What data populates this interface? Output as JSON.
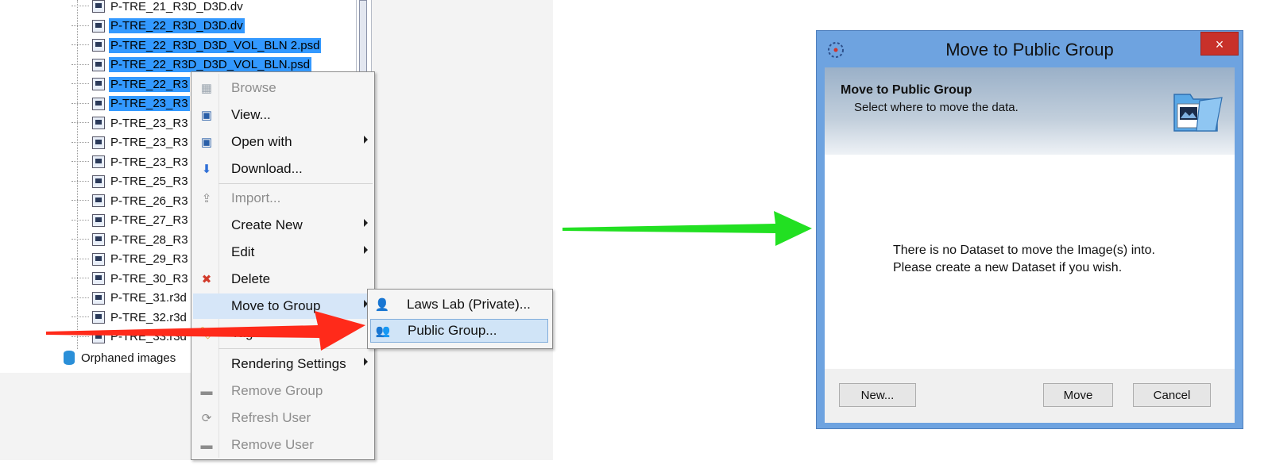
{
  "tree": {
    "items": [
      {
        "label": "P-TRE_21_R3D_D3D.dv",
        "selected": false
      },
      {
        "label": "P-TRE_22_R3D_D3D.dv",
        "selected": true
      },
      {
        "label": "P-TRE_22_R3D_D3D_VOL_BLN 2.psd",
        "selected": true
      },
      {
        "label": "P-TRE_22_R3D_D3D_VOL_BLN.psd",
        "selected": true
      },
      {
        "label": "P-TRE_22_R3",
        "selected": true
      },
      {
        "label": "P-TRE_23_R3",
        "selected": true
      },
      {
        "label": "P-TRE_23_R3",
        "selected": false
      },
      {
        "label": "P-TRE_23_R3",
        "selected": false
      },
      {
        "label": "P-TRE_23_R3",
        "selected": false
      },
      {
        "label": "P-TRE_25_R3",
        "selected": false
      },
      {
        "label": "P-TRE_26_R3",
        "selected": false
      },
      {
        "label": "P-TRE_27_R3",
        "selected": false
      },
      {
        "label": "P-TRE_28_R3",
        "selected": false
      },
      {
        "label": "P-TRE_29_R3",
        "selected": false
      },
      {
        "label": "P-TRE_30_R3",
        "selected": false
      },
      {
        "label": "P-TRE_31.r3d",
        "selected": false
      },
      {
        "label": "P-TRE_32.r3d",
        "selected": false
      },
      {
        "label": "P-TRE_33.r3d",
        "selected": false
      }
    ],
    "orphaned_label": "Orphaned images"
  },
  "context_menu": {
    "items": [
      {
        "label": "Browse",
        "icon": "browse-icon",
        "disabled": true,
        "submenu": false
      },
      {
        "label": "View...",
        "icon": "view-icon",
        "disabled": false,
        "submenu": false
      },
      {
        "label": "Open with",
        "icon": "open-with-icon",
        "disabled": false,
        "submenu": true
      },
      {
        "label": "Download...",
        "icon": "download-icon",
        "disabled": false,
        "submenu": false
      },
      {
        "label": "Import...",
        "icon": "import-icon",
        "disabled": true,
        "submenu": false
      },
      {
        "label": "Create New",
        "icon": "",
        "disabled": false,
        "submenu": true
      },
      {
        "label": "Edit",
        "icon": "",
        "disabled": false,
        "submenu": true
      },
      {
        "label": "Delete",
        "icon": "delete-icon",
        "disabled": false,
        "submenu": false
      },
      {
        "label": "Move to Group",
        "icon": "",
        "disabled": false,
        "submenu": true,
        "highlight": true
      },
      {
        "label": "Tag",
        "icon": "tag-icon",
        "disabled": false,
        "submenu": false
      },
      {
        "label": "Rendering Settings",
        "icon": "",
        "disabled": false,
        "submenu": true
      },
      {
        "label": "Remove Group",
        "icon": "remove-group-icon",
        "disabled": true,
        "submenu": false
      },
      {
        "label": "Refresh User",
        "icon": "refresh-icon",
        "disabled": true,
        "submenu": false
      },
      {
        "label": "Remove User",
        "icon": "remove-user-icon",
        "disabled": true,
        "submenu": false
      }
    ]
  },
  "submenu": {
    "items": [
      {
        "label": "Laws Lab (Private)...",
        "icon": "user-icon"
      },
      {
        "label": "Public Group...",
        "icon": "group-icon",
        "highlight": true
      }
    ]
  },
  "dialog": {
    "title": "Move to Public Group",
    "close_label": "×",
    "banner_heading": "Move to Public Group",
    "banner_sub": "Select where to move the data.",
    "message_line1": "There is no Dataset to move the Image(s) into.",
    "message_line2": "Please create a new Dataset if you wish.",
    "new_button": "New...",
    "move_button": "Move",
    "cancel_button": "Cancel"
  },
  "colors": {
    "selection": "#3399ff",
    "menu_highlight": "#d6e6f8",
    "dialog_frame": "#6ea3e0",
    "arrow_red": "#ff2a1a",
    "arrow_green": "#22e022"
  }
}
